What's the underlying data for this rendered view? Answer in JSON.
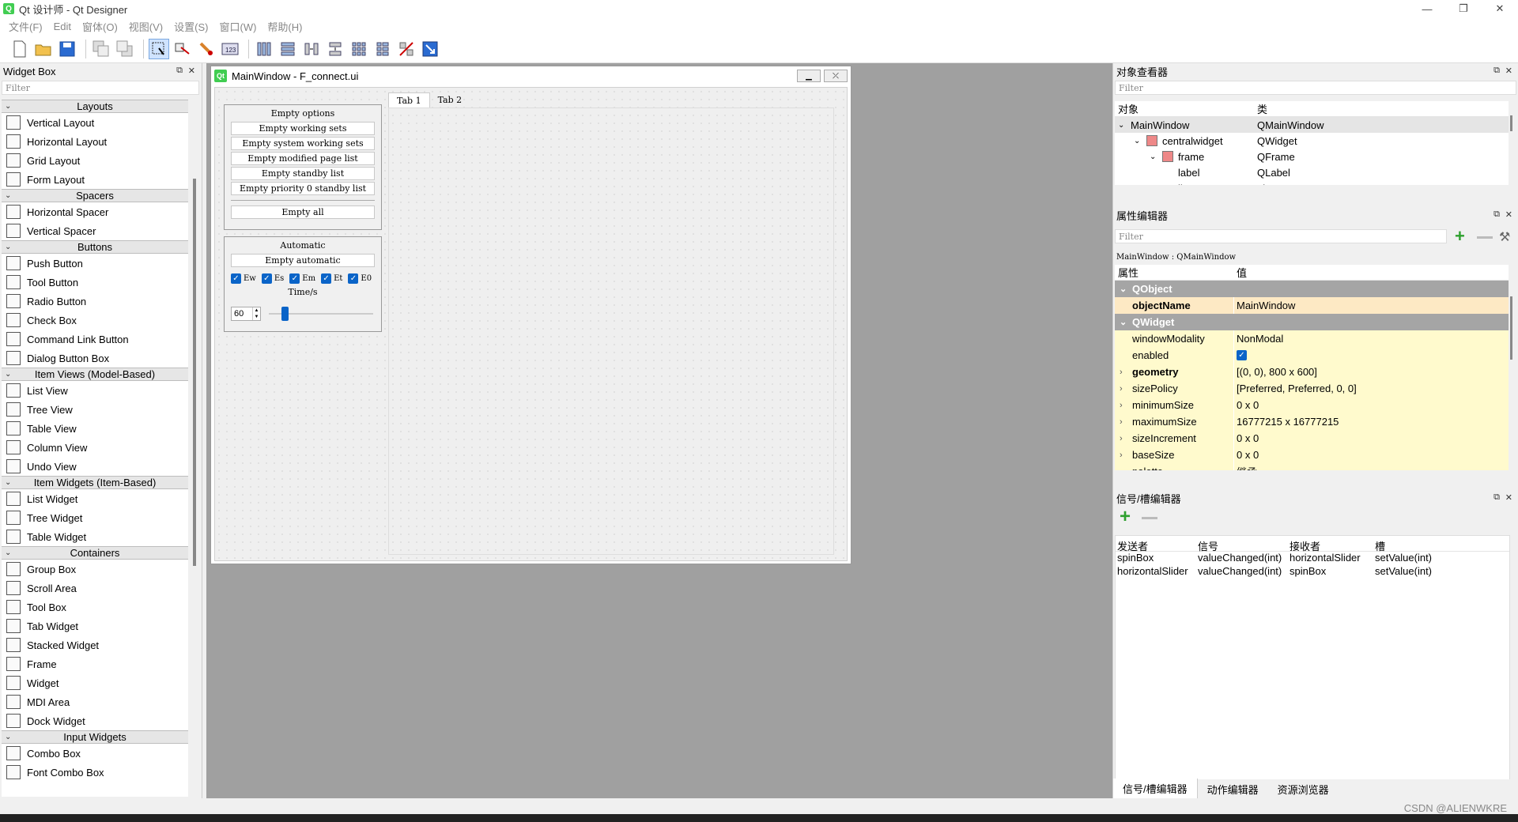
{
  "window": {
    "app_icon": "Q",
    "title": "Qt 设计师 - Qt Designer",
    "minimize": "—",
    "maximize": "❐",
    "close": "✕"
  },
  "menu": [
    "文件(F)",
    "Edit",
    "窗体(O)",
    "视图(V)",
    "设置(S)",
    "窗口(W)",
    "帮助(H)"
  ],
  "widget_box": {
    "title": "Widget Box",
    "filter_placeholder": "Filter",
    "categories": [
      {
        "name": "Layouts",
        "items": [
          "Vertical Layout",
          "Horizontal Layout",
          "Grid Layout",
          "Form Layout"
        ]
      },
      {
        "name": "Spacers",
        "items": [
          "Horizontal Spacer",
          "Vertical Spacer"
        ]
      },
      {
        "name": "Buttons",
        "items": [
          "Push Button",
          "Tool Button",
          "Radio Button",
          "Check Box",
          "Command Link Button",
          "Dialog Button Box"
        ]
      },
      {
        "name": "Item Views (Model-Based)",
        "items": [
          "List View",
          "Tree View",
          "Table View",
          "Column View",
          "Undo View"
        ]
      },
      {
        "name": "Item Widgets (Item-Based)",
        "items": [
          "List Widget",
          "Tree Widget",
          "Table Widget"
        ]
      },
      {
        "name": "Containers",
        "items": [
          "Group Box",
          "Scroll Area",
          "Tool Box",
          "Tab Widget",
          "Stacked Widget",
          "Frame",
          "Widget",
          "MDI Area",
          "Dock Widget"
        ]
      },
      {
        "name": "Input Widgets",
        "items": [
          "Combo Box",
          "Font Combo Box"
        ]
      }
    ]
  },
  "subwindow": {
    "title": "MainWindow - F_connect.ui",
    "tabs": [
      "Tab 1",
      "Tab 2"
    ],
    "group_options": {
      "title": "Empty options",
      "buttons": [
        "Empty working sets",
        "Empty system working sets",
        "Empty modified page list",
        "Empty standby list",
        "Empty priority 0 standby list"
      ],
      "empty_all": "Empty all"
    },
    "group_auto": {
      "title": "Automatic",
      "button": "Empty automatic",
      "checkboxes": [
        "Ew",
        "Es",
        "Em",
        "Et",
        "E0"
      ],
      "time_label": "Time/s",
      "spin_value": "60",
      "slider_fraction": 0.12
    }
  },
  "object_inspector": {
    "title": "对象查看器",
    "filter_placeholder": "Filter",
    "headers": [
      "对象",
      "类"
    ],
    "rows": [
      {
        "object": "MainWindow",
        "class": "QMainWindow"
      },
      {
        "object": "centralwidget",
        "class": "QWidget"
      },
      {
        "object": "frame",
        "class": "QFrame"
      },
      {
        "object": "label",
        "class": "QLabel"
      },
      {
        "object": "line",
        "class": "Line"
      }
    ]
  },
  "property_editor": {
    "title": "属性编辑器",
    "filter_placeholder": "Filter",
    "context": "MainWindow : QMainWindow",
    "headers": [
      "属性",
      "值"
    ],
    "sections": [
      {
        "name": "QObject",
        "rows": [
          {
            "name": "objectName",
            "value": "MainWindow"
          }
        ]
      },
      {
        "name": "QWidget",
        "rows": [
          {
            "name": "windowModality",
            "value": "NonModal"
          },
          {
            "name": "enabled",
            "value": ""
          },
          {
            "name": "geometry",
            "value": "[(0, 0), 800 x 600]"
          },
          {
            "name": "sizePolicy",
            "value": "[Preferred, Preferred, 0, 0]"
          },
          {
            "name": "minimumSize",
            "value": "0 x 0"
          },
          {
            "name": "maximumSize",
            "value": "16777215 x 16777215"
          },
          {
            "name": "sizeIncrement",
            "value": "0 x 0"
          },
          {
            "name": "baseSize",
            "value": "0 x 0"
          },
          {
            "name": "palette",
            "value": "继承"
          }
        ]
      }
    ]
  },
  "signal_slot_editor": {
    "title": "信号/槽编辑器",
    "headers": [
      "发送者",
      "信号",
      "接收者",
      "槽"
    ],
    "rows": [
      {
        "sender": "spinBox",
        "signal": "valueChanged(int)",
        "receiver": "horizontalSlider",
        "slot": "setValue(int)"
      },
      {
        "sender": "horizontalSlider",
        "signal": "valueChanged(int)",
        "receiver": "spinBox",
        "slot": "setValue(int)"
      }
    ]
  },
  "bottom_tabs": [
    "信号/槽编辑器",
    "动作编辑器",
    "资源浏览器"
  ],
  "watermark": "CSDN @ALIENWKRE"
}
